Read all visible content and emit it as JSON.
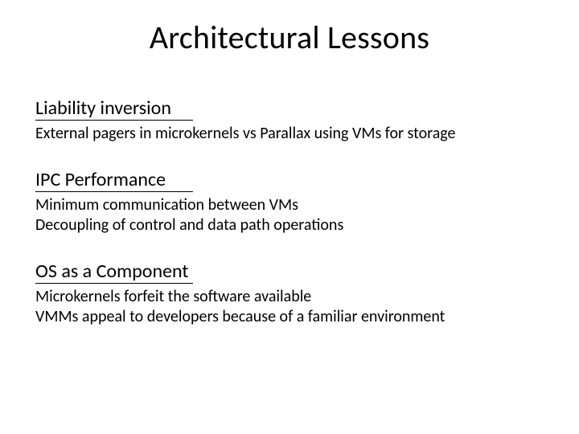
{
  "title": "Architectural Lessons",
  "sections": [
    {
      "heading": "Liability inversion",
      "bullets": [
        "External pagers in microkernels vs Parallax using VMs for storage"
      ]
    },
    {
      "heading": "IPC Performance",
      "bullets": [
        "Minimum communication between VMs",
        "Decoupling of control and data path operations"
      ]
    },
    {
      "heading": "OS as a Component",
      "bullets": [
        "Microkernels forfeit the software available",
        "VMMs appeal to developers because of a familiar environment"
      ]
    }
  ]
}
